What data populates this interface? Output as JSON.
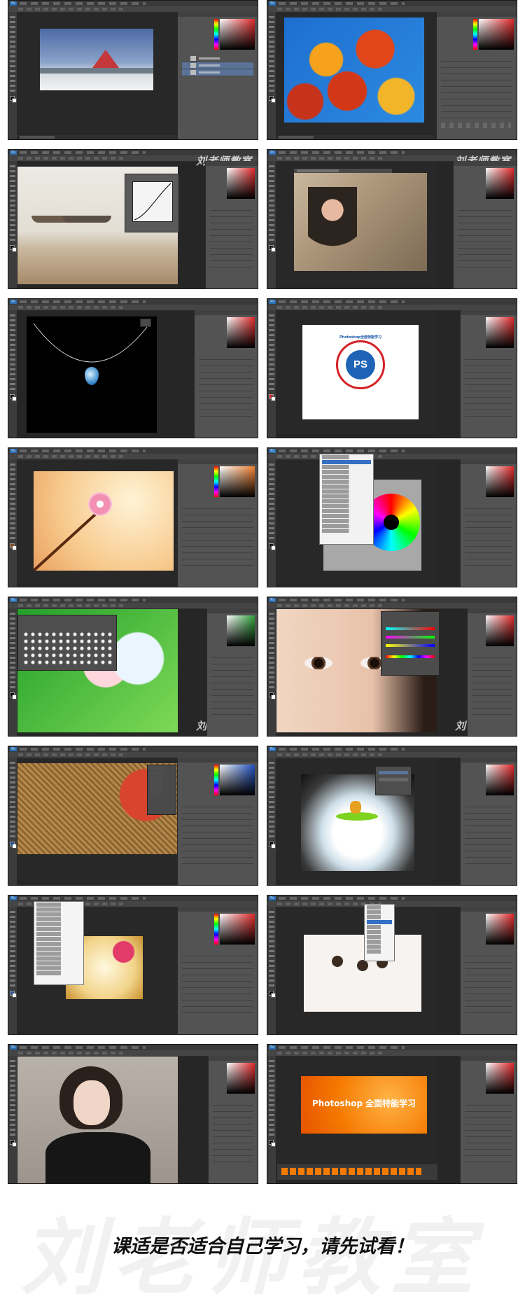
{
  "app": {
    "badge": "Ps"
  },
  "watermark": "刘老师教室",
  "screenshots": [
    {
      "id": "snow-house",
      "subject": "snow-landscape"
    },
    {
      "id": "autumn-leaves",
      "subject": "red-leaves"
    },
    {
      "id": "boats-curves",
      "subject": "boats-on-beach",
      "dialog": "curves"
    },
    {
      "id": "monkey",
      "subject": "monkey"
    },
    {
      "id": "necklace",
      "subject": "crystal-pendant"
    },
    {
      "id": "photoshop-stamp",
      "subject": "stamp",
      "stamp_text": "Photoshop全面特能学习",
      "stamp_center": "PS"
    },
    {
      "id": "cherry-blossom",
      "subject": "blossom-brush"
    },
    {
      "id": "color-wheel",
      "subject": "hue-ring",
      "menu": "filter-dropdown"
    },
    {
      "id": "brush-presets",
      "subject": "cartoon-characters"
    },
    {
      "id": "eyes-closeup",
      "subject": "face-eyes"
    },
    {
      "id": "burlap-apple",
      "subject": "fabric-texture"
    },
    {
      "id": "kayak",
      "subject": "kayak-waterfall"
    },
    {
      "id": "candy-menu",
      "subject": "candy-shop",
      "menu": "edit-dropdown"
    },
    {
      "id": "sketch-kids",
      "subject": "line-drawing",
      "menu": "mode-dropdown"
    },
    {
      "id": "portrait",
      "subject": "woman-portrait"
    },
    {
      "id": "banner",
      "subject": "orange-banner",
      "banner_text": "Photoshop 全面特能学习"
    }
  ],
  "bottom_watermark": "刘老师教室",
  "caption": "课适是否适合自己学习，请先试看！"
}
